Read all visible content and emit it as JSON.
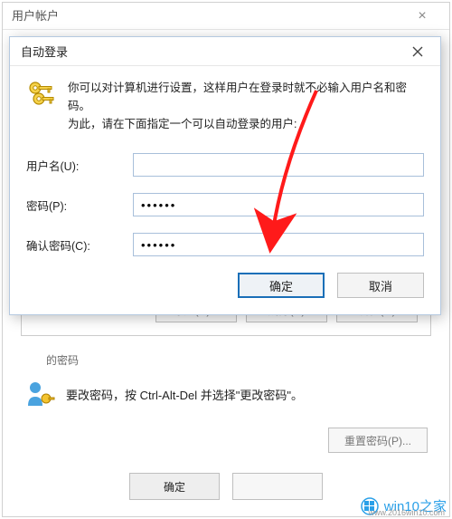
{
  "outer": {
    "title": "用户帐户",
    "buttons": {
      "add": "添加(D)...",
      "remove": "删除(R)",
      "properties": "属性(O)"
    },
    "password_section": {
      "title": "的密码",
      "hint": "要改密码，按 Ctrl-Alt-Del 并选择\"更改密码\"。",
      "reset": "重置密码(P)..."
    },
    "footer": {
      "ok": "确定"
    }
  },
  "modal": {
    "title": "自动登录",
    "intro_line1": "你可以对计算机进行设置，这样用户在登录时就不必输入用户名和密码。",
    "intro_line2": "为此，请在下面指定一个可以自动登录的用户:",
    "fields": {
      "username_label": "用户名(U):",
      "username_value": "",
      "password_label": "密码(P):",
      "password_value": "••••••",
      "confirm_label": "确认密码(C):",
      "confirm_value": "••••••"
    },
    "buttons": {
      "ok": "确定",
      "cancel": "取消"
    }
  },
  "watermark": {
    "text": "win10之家",
    "sub": "www.2016win10.com"
  }
}
